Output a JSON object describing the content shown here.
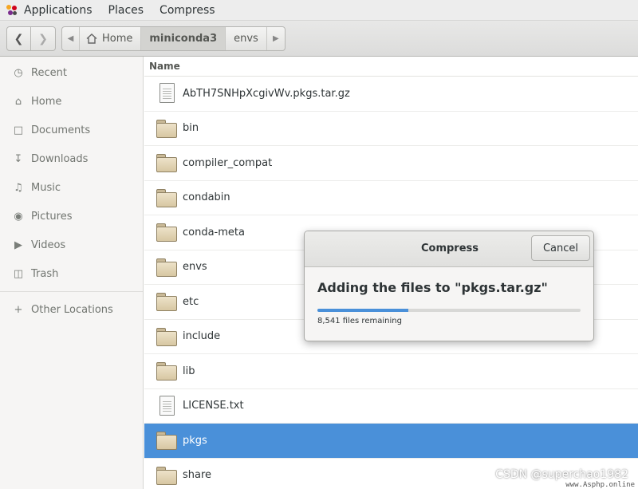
{
  "topbar": {
    "applications": "Applications",
    "places": "Places",
    "compress": "Compress"
  },
  "path": {
    "home": "Home",
    "current": "miniconda3",
    "next": "envs"
  },
  "sidebar": {
    "items": [
      {
        "label": "Recent",
        "icon": "clock-icon"
      },
      {
        "label": "Home",
        "icon": "home-icon"
      },
      {
        "label": "Documents",
        "icon": "document-icon"
      },
      {
        "label": "Downloads",
        "icon": "download-icon"
      },
      {
        "label": "Music",
        "icon": "music-icon"
      },
      {
        "label": "Pictures",
        "icon": "camera-icon"
      },
      {
        "label": "Videos",
        "icon": "video-icon"
      },
      {
        "label": "Trash",
        "icon": "trash-icon"
      }
    ],
    "other": "Other Locations"
  },
  "filelist": {
    "column_name": "Name",
    "files": [
      {
        "name": "AbTH7SNHpXcgivWv.pkgs.tar.gz",
        "type": "file"
      },
      {
        "name": "bin",
        "type": "folder"
      },
      {
        "name": "compiler_compat",
        "type": "folder"
      },
      {
        "name": "condabin",
        "type": "folder"
      },
      {
        "name": "conda-meta",
        "type": "folder"
      },
      {
        "name": "envs",
        "type": "folder"
      },
      {
        "name": "etc",
        "type": "folder"
      },
      {
        "name": "include",
        "type": "folder"
      },
      {
        "name": "lib",
        "type": "folder"
      },
      {
        "name": "LICENSE.txt",
        "type": "file"
      },
      {
        "name": "pkgs",
        "type": "folder",
        "selected": true
      },
      {
        "name": "share",
        "type": "folder"
      }
    ]
  },
  "dialog": {
    "title": "Compress",
    "cancel": "Cancel",
    "message": "Adding the files to \"pkgs.tar.gz\"",
    "progress": 0.345,
    "status": "8,541 files remaining"
  },
  "watermark": {
    "csdn": "CSDN @superchao1982",
    "site": "www.Asphp.online"
  },
  "colors": {
    "accent": "#4a90d9",
    "sidebar_bg": "#f6f5f4"
  }
}
